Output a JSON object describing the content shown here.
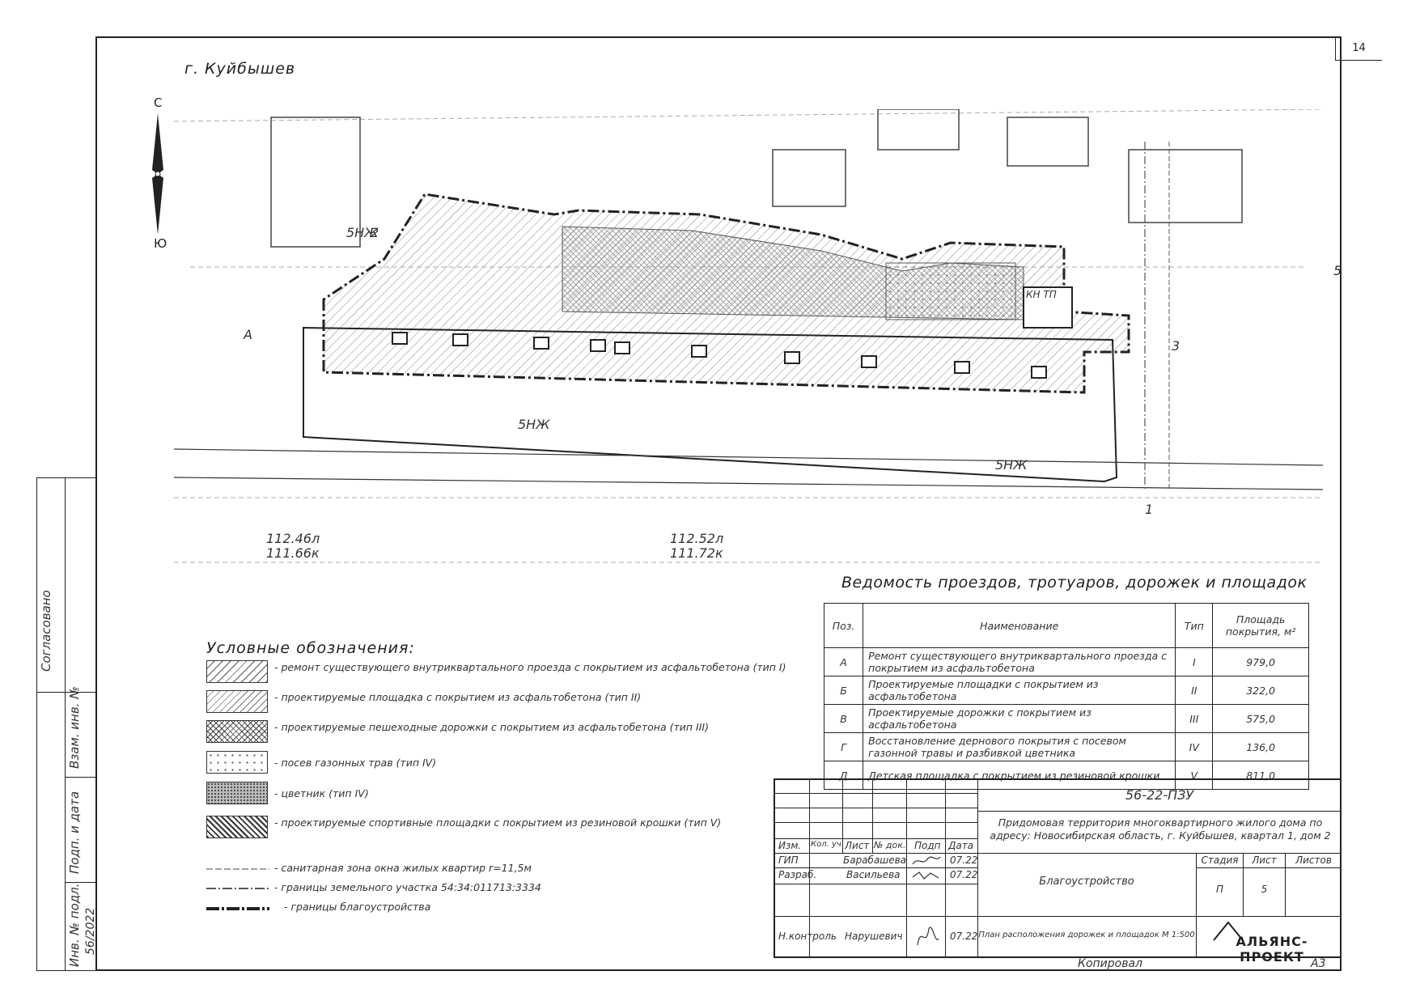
{
  "sheet_number": "14",
  "city": "г. Куйбышев",
  "compass": {
    "north": "С",
    "south": "Ю"
  },
  "map_labels": {
    "parcel_5nzh": "5НЖ",
    "building_2": "2",
    "building_1": "1",
    "building_3": "3",
    "kn_tp": "КН ТП",
    "zone_a": "А",
    "elev_1a": "112.46л",
    "elev_1b": "111.66к",
    "elev_2a": "112.52л",
    "elev_2b": "111.72к",
    "street_5": "5"
  },
  "legend": {
    "title": "Условные обозначения:",
    "items": [
      {
        "text": "- ремонт существующего внутриквартального проезда с покрытием из асфальтобетона (тип I)",
        "pattern": "hatch"
      },
      {
        "text": "- проектируемые площадка с покрытием из асфальтобетона (тип II)",
        "pattern": "hatch2"
      },
      {
        "text": "- проектируемые пешеходные дорожки с покрытием из асфальтобетона (тип III)",
        "pattern": "cross"
      },
      {
        "text": "- посев газонных трав (тип IV)",
        "pattern": "dots"
      },
      {
        "text": "- цветник (тип IV)",
        "pattern": "grey"
      },
      {
        "text": "- проектируемые спортивные площадки с покрытием из резиновой крошки (тип V)",
        "pattern": "dark"
      }
    ],
    "lines": [
      {
        "text": "- санитарная зона окна жилых квартир r=11,5м",
        "style": "thin-dash"
      },
      {
        "text": "- границы земельного участка 54:34:011713:3334",
        "style": "dash-dot"
      },
      {
        "text": "- границы благоустройства",
        "style": "bold-dash"
      }
    ]
  },
  "statement": {
    "title": "Ведомость проездов, тротуаров, дорожек и площадок",
    "headers": [
      "Поз.",
      "Наименование",
      "Тип",
      "Площадь покрытия, м²"
    ],
    "rows": [
      [
        "А",
        "Ремонт существующего внутриквартального проезда с покрытием из асфальтобетона",
        "I",
        "979,0"
      ],
      [
        "Б",
        "Проектируемые площадки с покрытием из асфальтобетона",
        "II",
        "322,0"
      ],
      [
        "В",
        "Проектируемые дорожки с покрытием из асфальтобетона",
        "III",
        "575,0"
      ],
      [
        "Г",
        "Восстановление дернового покрытия с посевом газонной травы и разбивкой цветника",
        "IV",
        "136,0"
      ],
      [
        "Д",
        "Детская площадка с покрытием из резиновой крошки",
        "V",
        "811,0"
      ]
    ]
  },
  "title_block": {
    "code": "56-22-ПЗУ",
    "project": "Придомовая территория многоквартирного жилого дома по адресу: Новосибирская область, г. Куйбышев, квартал 1, дом 2",
    "section": "Благоустройство",
    "sheet_title": "План расположения дорожек и площадок М 1:500",
    "company": "АЛЬЯНС-ПРОЕКТ",
    "col_headers": [
      "Изм.",
      "Кол. уч",
      "Лист",
      "№ док.",
      "Подп",
      "Дата"
    ],
    "stage_headers": [
      "Стадия",
      "Лист",
      "Листов"
    ],
    "stage": "П",
    "sheet": "5",
    "sheets_total": "",
    "people": [
      {
        "role": "ГИП",
        "name": "Барабашева",
        "date": "07.22"
      },
      {
        "role": "Разраб.",
        "name": "Васильева",
        "date": "07.22"
      },
      {
        "role": "Н.контроль",
        "name": "Нарушевич",
        "date": "07.22"
      }
    ]
  },
  "side": {
    "agreed": "Согласовано",
    "inv_zam": "Взам. инв. №",
    "sign_date": "Подп. и дата",
    "inv_orig": "Инв. № подл.",
    "inv_value": "56/2022"
  },
  "footer": {
    "copied": "Копировал",
    "format": "А3"
  }
}
